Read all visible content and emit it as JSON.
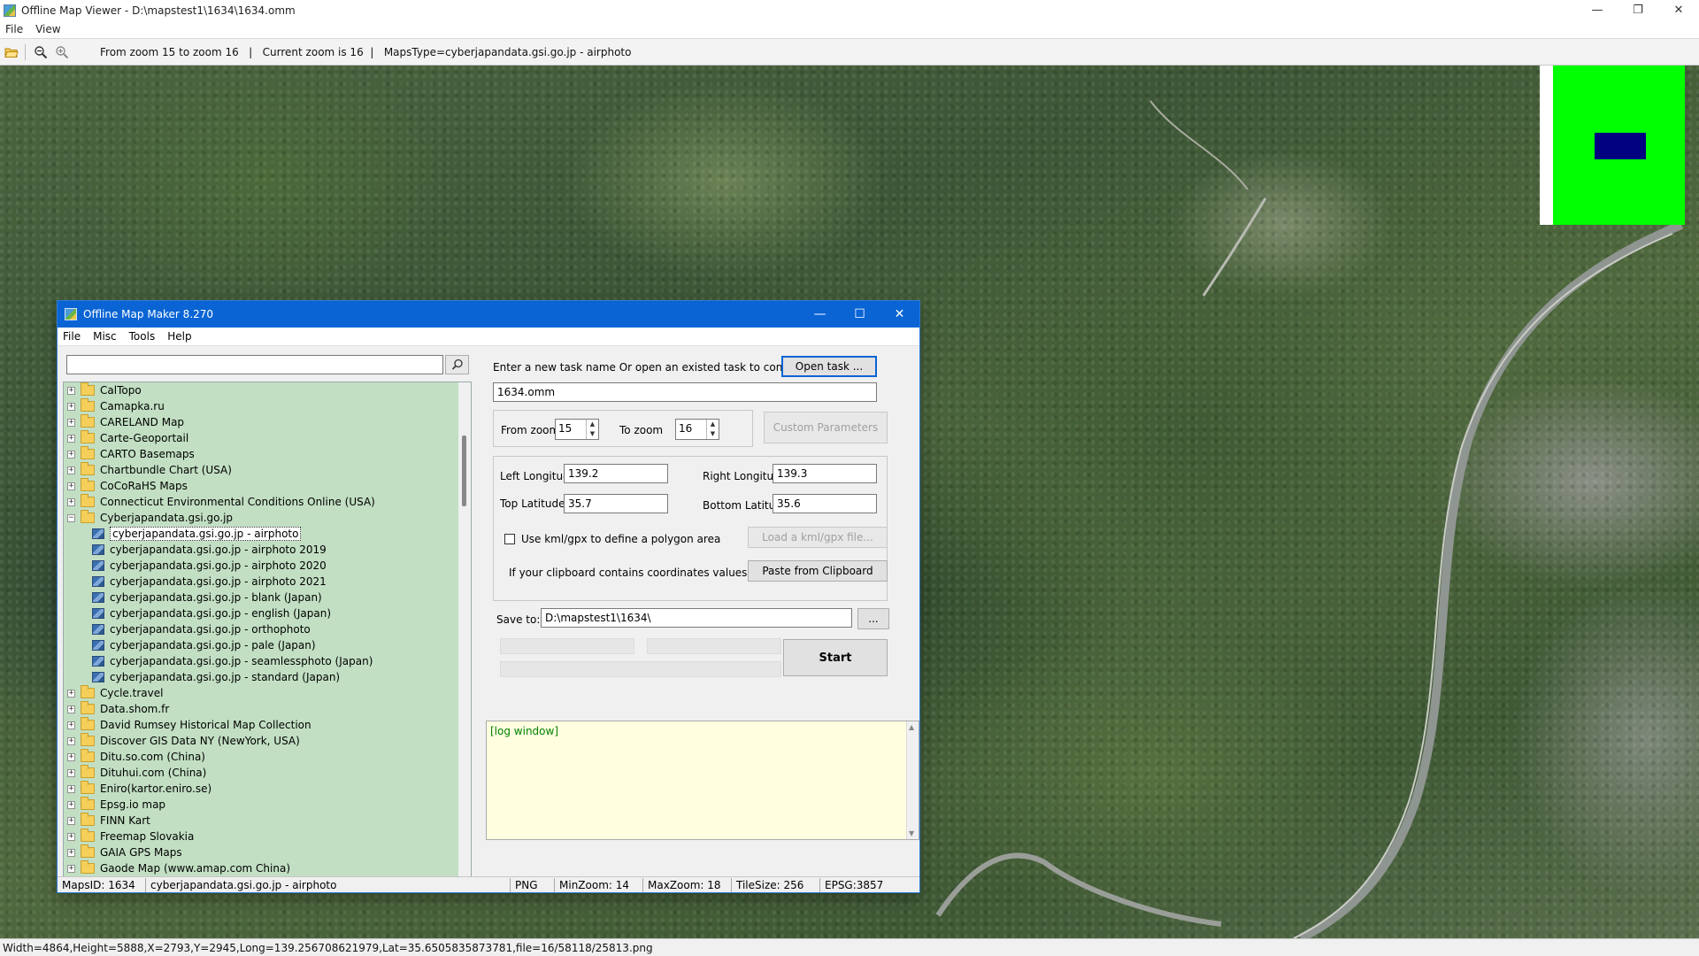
{
  "viewer": {
    "title": "Offline Map Viewer - D:\\mapstest1\\1634\\1634.omm",
    "menu": [
      "File",
      "View"
    ],
    "toolbar_text": "From zoom 15 to zoom 16   |   Current zoom is 16  |   MapsType=cyberjapandata.gsi.go.jp - airphoto",
    "statusbar": "Width=4864,Height=5888,X=2793,Y=2945,Long=139.256708621979,Lat=35.6505835873781,file=16/58118/25813.png",
    "icons": [
      "open-folder-icon",
      "zoom-out-icon",
      "zoom-in-icon"
    ]
  },
  "dialog": {
    "title": "Offline Map Maker 8.270",
    "menu": [
      "File",
      "Misc",
      "Tools",
      "Help"
    ],
    "search": {
      "value": "",
      "placeholder": ""
    },
    "tree": {
      "top_items_before": [
        "CalTopo",
        "Camapka.ru",
        "CARELAND Map",
        "Carte-Geoportail",
        "CARTO Basemaps",
        "Chartbundle Chart (USA)",
        "CoCoRaHS Maps",
        "Connecticut Environmental Conditions Online (USA)"
      ],
      "expanded_item": "Cyberjapandata.gsi.go.jp",
      "children": [
        "cyberjapandata.gsi.go.jp - airphoto",
        "cyberjapandata.gsi.go.jp - airphoto 2019",
        "cyberjapandata.gsi.go.jp - airphoto 2020",
        "cyberjapandata.gsi.go.jp - airphoto 2021",
        "cyberjapandata.gsi.go.jp - blank (Japan)",
        "cyberjapandata.gsi.go.jp - english (Japan)",
        "cyberjapandata.gsi.go.jp - orthophoto",
        "cyberjapandata.gsi.go.jp - pale (Japan)",
        "cyberjapandata.gsi.go.jp - seamlessphoto (Japan)",
        "cyberjapandata.gsi.go.jp - standard (Japan)"
      ],
      "selected_child": "cyberjapandata.gsi.go.jp - airphoto",
      "top_items_after": [
        "Cycle.travel",
        "Data.shom.fr",
        "David Rumsey Historical Map Collection",
        "Discover GIS Data NY (NewYork, USA)",
        "Ditu.so.com (China)",
        "Dituhui.com (China)",
        "Eniro(kartor.eniro.se)",
        "Epsg.io map",
        "FINN Kart",
        "Freemap Slovakia",
        "GAIA GPS Maps",
        "Gaode Map (www.amap.com China)"
      ]
    },
    "task": {
      "prompt": "Enter a new task name Or open an existed task to continue:",
      "open_button": "Open task ...",
      "name_value": "1634.omm"
    },
    "zoom": {
      "from_label": "From zoom",
      "from_value": "15",
      "to_label": "To zoom",
      "to_value": "16",
      "custom_button": "Custom Parameters"
    },
    "coords": {
      "left_lon_label": "Left Longitude",
      "left_lon_value": "139.2",
      "right_lon_label": "Right Longitude",
      "right_lon_value": "139.3",
      "top_lat_label": "Top Latitude",
      "top_lat_value": "35.7",
      "bottom_lat_label": "Bottom Latitude",
      "bottom_lat_value": "35.6",
      "kml_checkbox_label": "Use kml/gpx to define a polygon area",
      "kml_checked": false,
      "kml_button": "Load a kml/gpx file...",
      "clipboard_label": "If your clipboard contains coordinates values:",
      "clipboard_button": "Paste from Clipboard"
    },
    "save": {
      "label": "Save to:",
      "path": "D:\\mapstest1\\1634\\",
      "browse_button": "...",
      "start_button": "Start"
    },
    "log": {
      "text": "[log window]"
    },
    "statusbar": {
      "maps_id": "MapsID: 1634",
      "maps_name": "cyberjapandata.gsi.go.jp - airphoto",
      "format": "PNG",
      "min_zoom": "MinZoom: 14",
      "max_zoom": "MaxZoom: 18",
      "tile_size": "TileSize: 256",
      "epsg": "EPSG:3857"
    }
  },
  "colors": {
    "dialog_titlebar": "#0a64d4",
    "tree_background": "#c2dfc3",
    "log_background": "#ffffe0",
    "minimap_background": "#00ff00",
    "minimap_viewport": "#000080"
  }
}
